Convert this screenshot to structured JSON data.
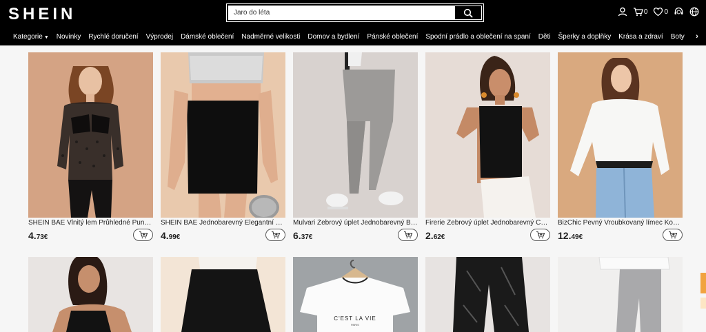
{
  "brand": {
    "logo": "SHEIN"
  },
  "search": {
    "placeholder": "Jaro do léta"
  },
  "header": {
    "cart_count": "0",
    "wishlist_count": "0"
  },
  "nav": {
    "items": [
      {
        "label": "Kategorie"
      },
      {
        "label": "Novinky"
      },
      {
        "label": "Rychlé doručení"
      },
      {
        "label": "Výprodej"
      },
      {
        "label": "Dámské oblečení"
      },
      {
        "label": "Nadměrné velikosti"
      },
      {
        "label": "Domov a bydlení"
      },
      {
        "label": "Pánské oblečení"
      },
      {
        "label": "Spodní prádlo a oblečení na spaní"
      },
      {
        "label": "Děti"
      },
      {
        "label": "Šperky a doplňky"
      },
      {
        "label": "Krása a zdraví"
      },
      {
        "label": "Boty"
      }
    ]
  },
  "products": [
    {
      "title": "SHEIN BAE Vlnitý lem Průhledné Puntík...",
      "price_int": "4.",
      "price_dec": "73€"
    },
    {
      "title": "SHEIN BAE Jednobarevný Elegantní Dá...",
      "price_int": "4.",
      "price_dec": "99€"
    },
    {
      "title": "Mulvari Žebrový úplet Jednobarevný Ba...",
      "price_int": "6.",
      "price_dec": "37€"
    },
    {
      "title": "Firerie Žebrový úplet Jednobarevný Cas...",
      "price_int": "2.",
      "price_dec": "62€"
    },
    {
      "title": "BizChic Pevný Vroubkovaný límec Košile...",
      "price_int": "12.",
      "price_dec": "49€"
    }
  ],
  "products_row2": [
    {
      "name": "product-image"
    },
    {
      "name": "product-image"
    },
    {
      "name": "product-image",
      "print_text": "C'EST LA VIE",
      "print_sub": "PARIS"
    },
    {
      "name": "product-image"
    },
    {
      "name": "product-image"
    }
  ],
  "colors": {
    "header_bg": "#000000",
    "page_bg": "#f6f6f6",
    "accent_tab": "#f1a340"
  }
}
